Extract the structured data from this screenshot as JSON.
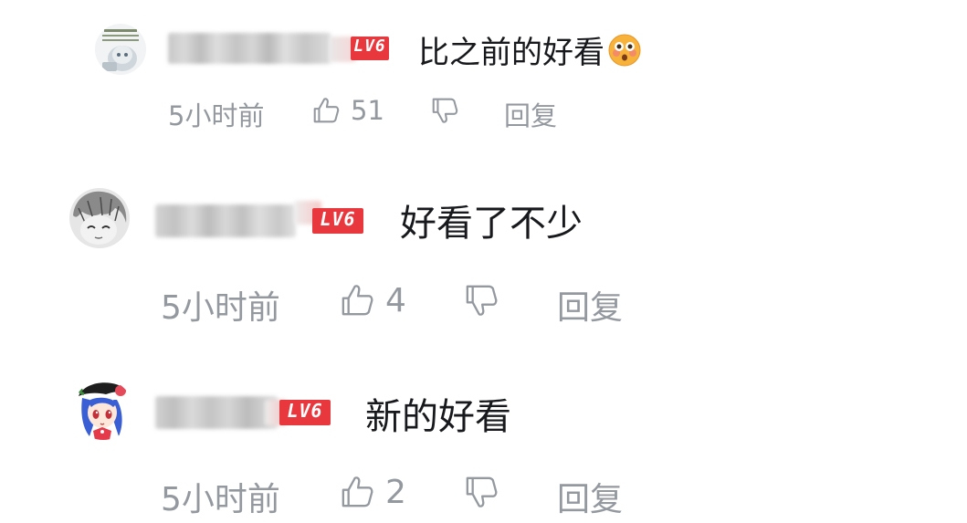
{
  "colors": {
    "text_primary": "#18191c",
    "text_secondary": "#9499a0",
    "level_badge": "#e8383d",
    "background": "#ffffff"
  },
  "comments": [
    {
      "level": "LV6",
      "text": "比之前的好看",
      "emoji_icon": "flushed-face-icon",
      "time": "5小时前",
      "likes": "51",
      "reply_label": "回复"
    },
    {
      "level": "LV6",
      "text": "好看了不少",
      "time": "5小时前",
      "likes": "4",
      "reply_label": "回复"
    },
    {
      "level": "LV6",
      "text": "新的好看",
      "time": "5小时前",
      "likes": "2",
      "reply_label": "回复"
    }
  ]
}
